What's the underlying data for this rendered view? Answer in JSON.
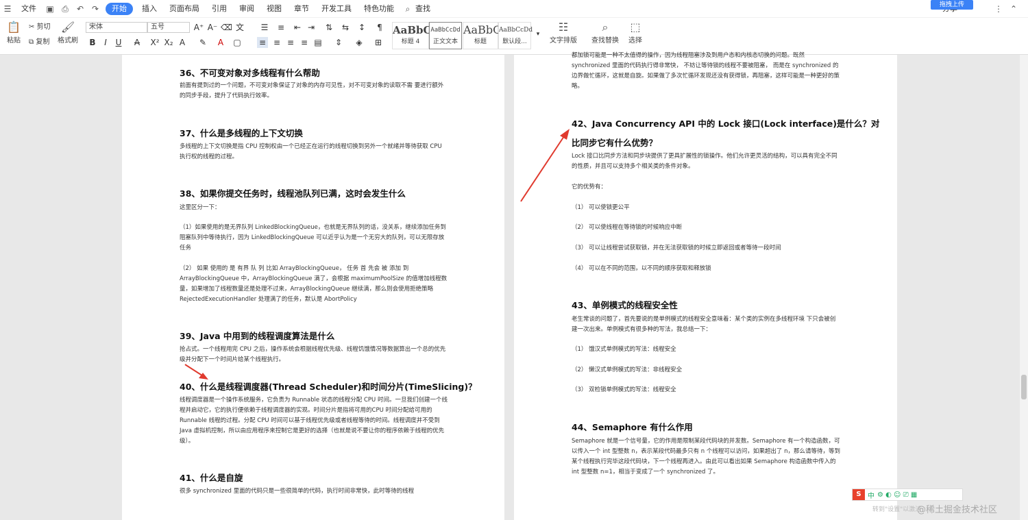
{
  "menubar": {
    "file": "文件",
    "tabs": [
      "开始",
      "插入",
      "页面布局",
      "引用",
      "审阅",
      "视图",
      "章节",
      "开发工具",
      "特色功能"
    ],
    "search": "查找",
    "upload": "拖拽上传",
    "share": "分享"
  },
  "ribbon": {
    "paste": "粘贴",
    "cut": "剪切",
    "copy": "复制",
    "format_painter": "格式刷",
    "font_name": "宋体",
    "font_size": "五号",
    "styles": [
      {
        "sample": "AaBbC",
        "name": "标题 4"
      },
      {
        "sample": "AaBbCcDd",
        "name": "正文文本"
      },
      {
        "sample": "AaBbC",
        "name": "标题"
      },
      {
        "sample": "AaBbCcDd",
        "name": "默认段..."
      }
    ],
    "text_layout": "文字排版",
    "find_replace": "查找替换",
    "select": "选择"
  },
  "left_page": {
    "h36": "36、不可变对象对多线程有什么帮助",
    "p36": "前面有提到过的一个问题，不可变对象保证了对象的内存可见性，对不可变对象的读取不需 要进行额外的同步手段，提升了代码执行效率。",
    "h37": "37、什么是多线程的上下文切换",
    "p37": "多线程的上下文切换是指 CPU 控制权由一个已经正在运行的线程切换到另外一个就绪并等待获取 CPU 执行权的线程的过程。",
    "h38": "38、如果你提交任务时，线程池队列已满，这时会发生什么",
    "p38a": "这里区分一下：",
    "p38b": "（1）如果使用的是无界队列 LinkedBlockingQueue，也就是无界队列的话，没关系，继续添加任务到阻塞队列中等待执行，因为 LinkedBlockingQueue 可以近乎认为是一个无穷大的队列，可以无限存放任务",
    "p38c": "（2） 如果 使用的 是 有界 队 列 比如 ArrayBlockingQueue， 任务 首 先会 被 添加 到 ArrayBlockingQueue 中，ArrayBlockingQueue 满了，会根据 maximumPoolSize 的值增加线程数量，如果增加了线程数量还是处理不过来，ArrayBlockingQueue 继续满，那么则会使用拒绝策略 RejectedExecutionHandler 处理满了的任务，默认是 AbortPolicy",
    "h39": "39、Java 中用到的线程调度算法是什么",
    "p39": "抢占式。一个线程用完 CPU 之后，操作系统会根据线程优先级、线程饥饿情况等数据算出一个总的优先级并分配下一个时间片给某个线程执行。",
    "h40": "40、什么是线程调度器(Thread Scheduler)和时间分片(TimeSlicing)？",
    "p40": "线程调度器是一个操作系统服务，它负责为 Runnable 状态的线程分配 CPU 时间。一旦我们创建一个线程并启动它，它的执行便依赖于线程调度器的实现。时间分片是指将可用的CPU 时间分配给可用的 Runnable 线程的过程。分配 CPU 时间可以基于线程优先级或者线程等待的时间。线程调度并不受到 Java 虚拟机控制，所以由应用程序来控制它是更好的选择（也就是说不要让你的程序依赖于线程的优先级）。",
    "h41": "41、什么是自旋",
    "p41": "很多 synchronized 里面的代码只是一些很简单的代码，执行时间非常快，此时等待的线程"
  },
  "right_page": {
    "p41b": "都加锁可能是一种不太值得的操作，因为线程阻塞涉及到用户态和内核态切换的问题。既然 synchronized 里面的代码执行得非常快， 不妨让等待锁的线程不要被阻塞， 而是在 synchronized 的边界做忙循环，这就是自旋。如果做了多次忙循环发现还没有获得锁，再阻塞，这样可能是一种更好的策略。",
    "h42a": "42、Java Concurrency API 中的  Lock 接口(Lock interface)是什么？对",
    "h42b": "比同步它有什么优势？",
    "p42": "Lock 接口比同步方法和同步块提供了更具扩展性的锁操作。他们允许更灵活的结构，可以具有完全不同的性质，并且可以支持多个相关类的条件对象。",
    "p42adv": "它的优势有：",
    "adv": [
      "（1） 可以使锁更公平",
      "（2） 可以使线程在等待锁的时候响应中断",
      "（3） 可以让线程尝试获取锁，并在无法获取锁的时候立即返回或者等待一段时间",
      "（4） 可以在不同的范围，以不同的顺序获取和释放锁"
    ],
    "h43": "43、单例模式的线程安全性",
    "p43": "老生常谈的问题了，首先要说的是单例模式的线程安全意味着：某个类的实例在多线程环境 下只会被创建一次出来。单例模式有很多种的写法，我总结一下：",
    "singleton": [
      "（1） 饿汉式单例模式的写法：线程安全",
      "（2） 懒汉式单例模式的写法：非线程安全",
      "（3） 双检锁单例模式的写法：线程安全"
    ],
    "h44": "44、Semaphore 有什么作用",
    "p44": "Semaphore 就是一个信号量，它的作用是限制某段代码块的并发数。Semaphore 有一个构造函数，可以传入一个 int 型整数 n，表示某段代码最多只有 n 个线程可以访问，如果超出了 n，那么请等待，等到某个线程执行完毕这段代码块，下一个线程再进入。由此可以看出如果 Semaphore 构造函数中传入的 int 型整数 n=1，相当于变成了一个 synchronized 了。"
  },
  "overlay": {
    "ime_logo": "S",
    "ime_label": "中",
    "watermark": "@稀土掘金技术社区",
    "watermark_small": "转到\"设置\"以激活"
  }
}
